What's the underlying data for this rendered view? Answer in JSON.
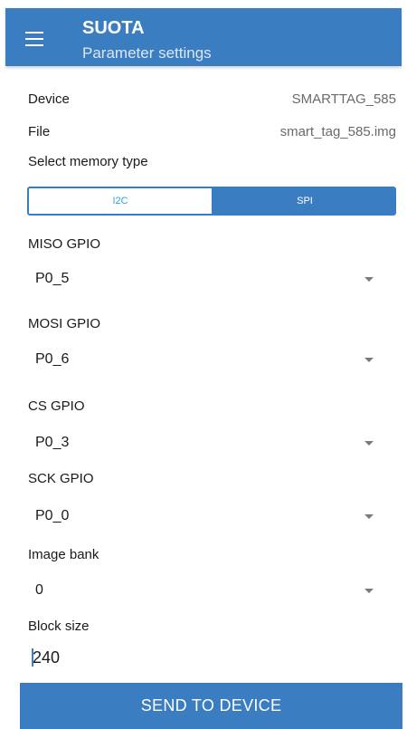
{
  "appbar": {
    "title": "SUOTA",
    "subtitle": "Parameter settings",
    "menu_icon": "menu-icon"
  },
  "info": {
    "device_label": "Device",
    "device_value": "SMARTTAG_585",
    "file_label": "File",
    "file_value": "smart_tag_585.img"
  },
  "memory": {
    "label": "Select memory type",
    "options": [
      "I2C",
      "SPI"
    ],
    "selected": "SPI"
  },
  "fields": [
    {
      "label": "MISO GPIO",
      "value": "P0_5"
    },
    {
      "label": "MOSI GPIO",
      "value": "P0_6"
    },
    {
      "label": "CS GPIO",
      "value": "P0_3"
    },
    {
      "label": "SCK GPIO",
      "value": "P0_0"
    },
    {
      "label": "Image bank",
      "value": "0"
    }
  ],
  "block_size": {
    "label": "Block size",
    "value": "240"
  },
  "send_button": "SEND TO DEVICE",
  "colors": {
    "primary": "#3a7dc1",
    "accent_text": "#29a3e6"
  }
}
